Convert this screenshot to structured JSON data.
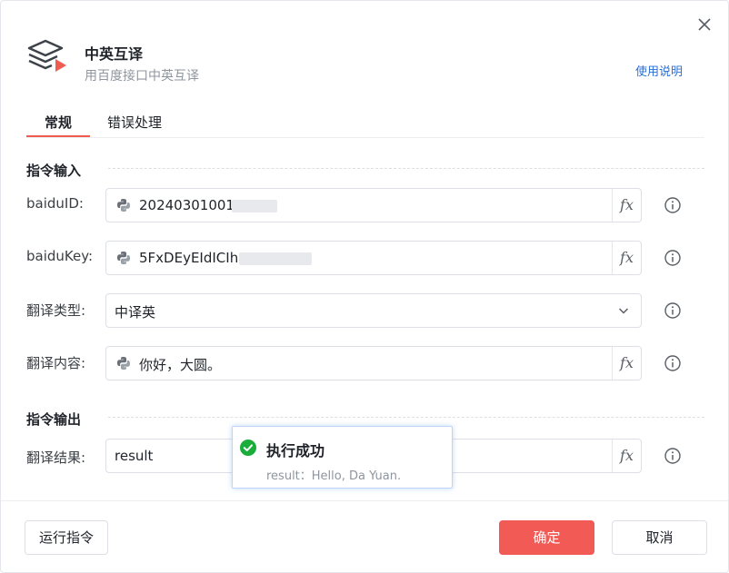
{
  "header": {
    "title": "中英互译",
    "subtitle": "用百度接口中英互译",
    "help_link": "使用说明"
  },
  "tabs": [
    {
      "label": "常规",
      "active": true
    },
    {
      "label": "错误处理",
      "active": false
    }
  ],
  "sections": {
    "input_title": "指令输入",
    "output_title": "指令输出"
  },
  "fields": {
    "baidu_id": {
      "label": "baiduID:",
      "value": "202403010011"
    },
    "baidu_key": {
      "label": "baiduKey:",
      "value": "5FxDEyEIdICIh"
    },
    "translate_type": {
      "label": "翻译类型:",
      "value": "中译英"
    },
    "translate_content": {
      "label": "翻译内容:",
      "value": "你好，大圆。"
    },
    "translate_result": {
      "label": "翻译结果:",
      "value": "result"
    }
  },
  "fx_label": "fx",
  "toast": {
    "title": "执行成功",
    "message": "result：Hello, Da Yuan."
  },
  "footer": {
    "run_label": "运行指令",
    "ok_label": "确定",
    "cancel_label": "取消"
  },
  "colors": {
    "accent": "#f05b50",
    "primary_button": "#f25a56",
    "link": "#2b6fd6",
    "success": "#1aad3b"
  },
  "icons": {
    "close": "close-icon",
    "logo": "layers-play-icon",
    "python": "python-icon",
    "info": "info-icon",
    "caret": "chevron-down-icon",
    "success": "check-circle-icon"
  }
}
